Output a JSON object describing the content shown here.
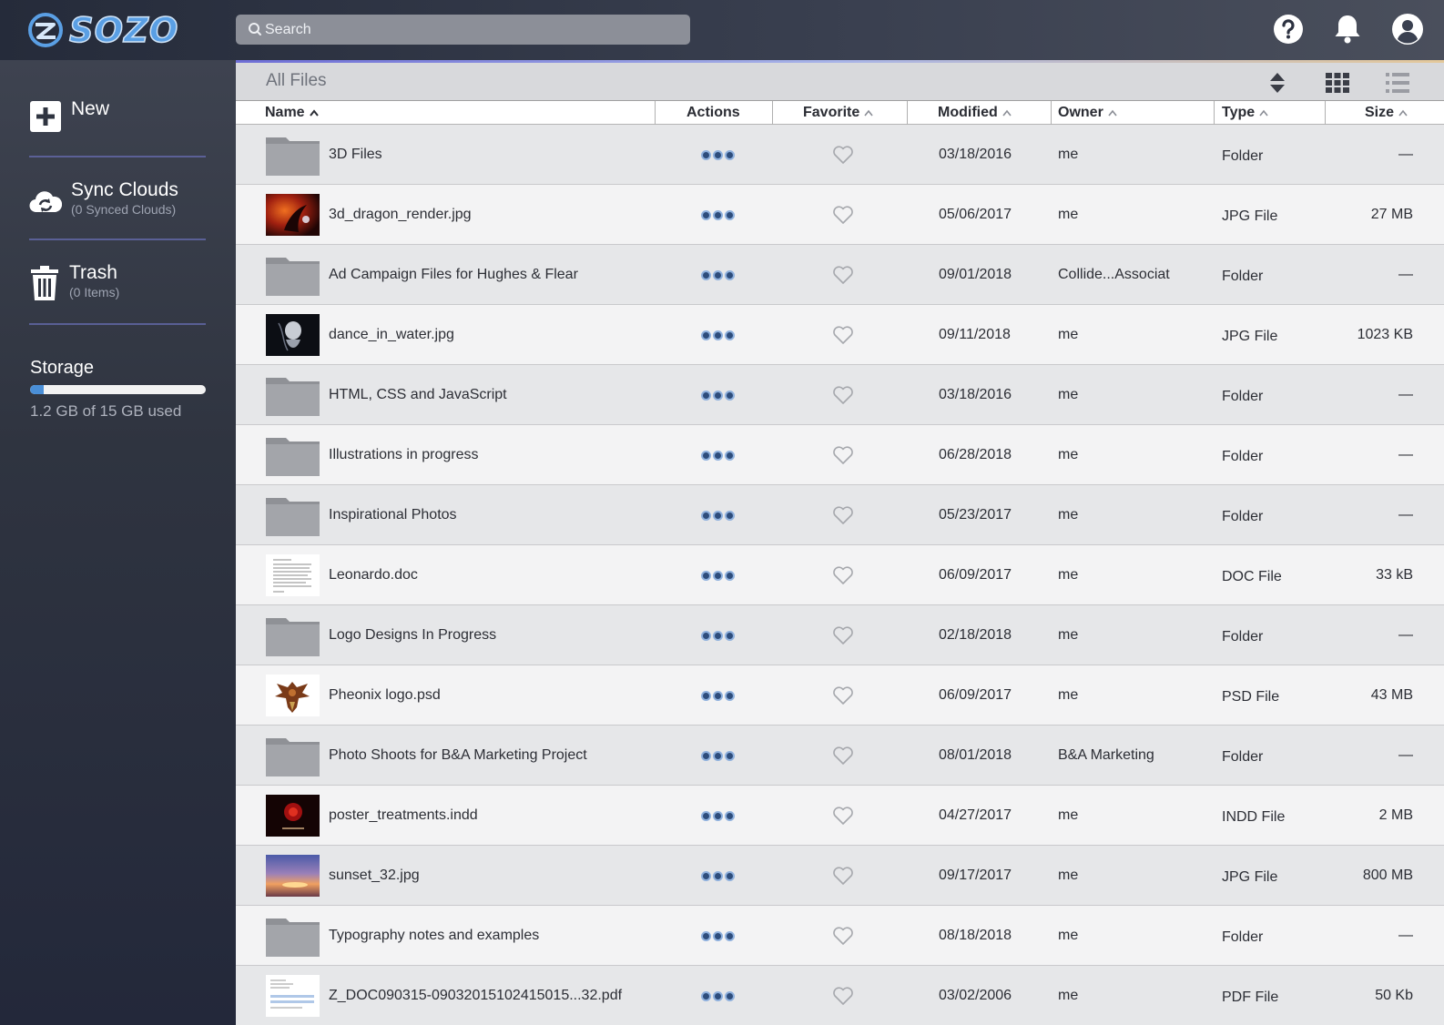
{
  "brand": {
    "logo_text": "SOZO"
  },
  "search": {
    "placeholder": "Search"
  },
  "sidebar": {
    "new_label": "New",
    "sync": {
      "title": "Sync Clouds",
      "subtitle": "(0 Synced Clouds)"
    },
    "trash": {
      "title": "Trash",
      "subtitle": "(0 Items)"
    },
    "storage": {
      "title": "Storage",
      "used_text": "1.2 GB of 15 GB used",
      "used_fraction": 0.08
    }
  },
  "files": {
    "title": "All Files",
    "columns": {
      "name": "Name",
      "actions": "Actions",
      "favorite": "Favorite",
      "modified": "Modified",
      "owner": "Owner",
      "type": "Type",
      "size": "Size"
    },
    "rows": [
      {
        "name": "3D Files",
        "modified": "03/18/2016",
        "owner": "me",
        "type": "Folder",
        "size": "—",
        "thumb": "folder"
      },
      {
        "name": "3d_dragon_render.jpg",
        "modified": "05/06/2017",
        "owner": "me",
        "type": "JPG File",
        "size": "27 MB",
        "thumb": "dragon"
      },
      {
        "name": "Ad Campaign Files for Hughes & Flear",
        "modified": "09/01/2018",
        "owner": "Collide...Associat",
        "type": "Folder",
        "size": "—",
        "thumb": "folder"
      },
      {
        "name": "dance_in_water.jpg",
        "modified": "09/11/2018",
        "owner": "me",
        "type": "JPG File",
        "size": "1023 KB",
        "thumb": "dance"
      },
      {
        "name": "HTML, CSS and JavaScript",
        "modified": "03/18/2016",
        "owner": "me",
        "type": "Folder",
        "size": "—",
        "thumb": "folder"
      },
      {
        "name": "Illustrations in progress",
        "modified": "06/28/2018",
        "owner": "me",
        "type": "Folder",
        "size": "—",
        "thumb": "folder"
      },
      {
        "name": "Inspirational Photos",
        "modified": "05/23/2017",
        "owner": "me",
        "type": "Folder",
        "size": "—",
        "thumb": "folder"
      },
      {
        "name": "Leonardo.doc",
        "modified": "06/09/2017",
        "owner": "me",
        "type": "DOC File",
        "size": "33 kB",
        "thumb": "doc"
      },
      {
        "name": "Logo Designs In Progress",
        "modified": "02/18/2018",
        "owner": "me",
        "type": "Folder",
        "size": "—",
        "thumb": "folder"
      },
      {
        "name": "Pheonix logo.psd",
        "modified": "06/09/2017",
        "owner": "me",
        "type": "PSD File",
        "size": "43 MB",
        "thumb": "phoenix"
      },
      {
        "name": "Photo Shoots for B&A Marketing Project",
        "modified": "08/01/2018",
        "owner": "B&A Marketing",
        "type": "Folder",
        "size": "—",
        "thumb": "folder"
      },
      {
        "name": "poster_treatments.indd",
        "modified": "04/27/2017",
        "owner": "me",
        "type": "INDD File",
        "size": "2 MB",
        "thumb": "poster"
      },
      {
        "name": "sunset_32.jpg",
        "modified": "09/17/2017",
        "owner": "me",
        "type": "JPG File",
        "size": "800 MB",
        "thumb": "sunset"
      },
      {
        "name": "Typography notes and examples",
        "modified": "08/18/2018",
        "owner": "me",
        "type": "Folder",
        "size": "—",
        "thumb": "folder"
      },
      {
        "name": "Z_DOC090315-09032015102415015...32.pdf",
        "modified": "03/02/2006",
        "owner": "me",
        "type": "PDF File",
        "size": "50 Kb",
        "thumb": "pdf"
      }
    ]
  },
  "colors": {
    "accent": "#4a8fd8",
    "topbar": "#2c3140",
    "sidebar": "#2f3440"
  }
}
